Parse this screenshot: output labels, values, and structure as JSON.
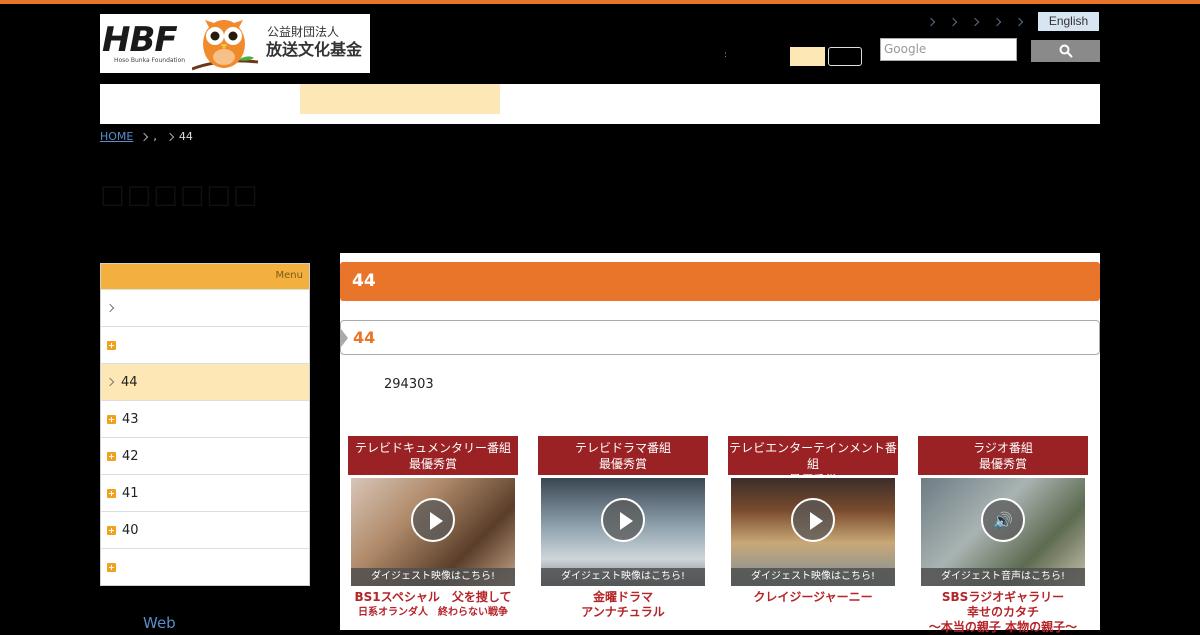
{
  "logo": {
    "mark": "HBF",
    "tagline": "Hoso Bunka Foundation",
    "org_line1": "公益財団法人",
    "org_line2": "放送文化基金"
  },
  "header": {
    "english_label": "English",
    "colon": ":",
    "search_placeholder": "Google"
  },
  "breadcrumb": {
    "home": "HOME",
    "middle": ",",
    "current": "44"
  },
  "page_title": "□□□□□□",
  "sidebar": {
    "menu_label": "Menu",
    "items": [
      {
        "label": "",
        "icon": "chevron-right-icon"
      },
      {
        "label": "",
        "icon": "plus-icon"
      },
      {
        "label": "44",
        "icon": "chevron-right-icon"
      },
      {
        "label": "43",
        "icon": "plus-icon"
      },
      {
        "label": "42",
        "icon": "plus-icon"
      },
      {
        "label": "41",
        "icon": "plus-icon"
      },
      {
        "label": "40",
        "icon": "plus-icon"
      },
      {
        "label": "",
        "icon": "plus-icon"
      }
    ]
  },
  "web_link": "Web",
  "main": {
    "title": "44",
    "subtitle": "44",
    "count": "294303"
  },
  "cards": [
    {
      "head1": "テレビドキュメンタリー番組",
      "head2": "最優秀賞",
      "strip": "ダイジェスト映像はこちら!",
      "title1": "BS1スペシャル　父を捜して",
      "title2": "日系オランダ人　終わらない戦争",
      "media": "play-icon"
    },
    {
      "head1": "テレビドラマ番組",
      "head2": "最優秀賞",
      "strip": "ダイジェスト映像はこちら!",
      "title1": "金曜ドラマ",
      "title2": "アンナチュラル",
      "media": "play-icon"
    },
    {
      "head1": "テレビエンターテインメント番組",
      "head2": "最優秀賞",
      "strip": "ダイジェスト映像はこちら!",
      "title1": "",
      "title2": "クレイジージャーニー",
      "media": "play-icon"
    },
    {
      "head1": "ラジオ番組",
      "head2": "最優秀賞",
      "strip": "ダイジェスト音声はこちら!",
      "title1": "SBSラジオギャラリー",
      "title2": "幸せのカタチ",
      "title3": "～本当の親子 本物の親子～",
      "media": "speaker-icon"
    }
  ],
  "colors": {
    "accent_orange": "#e8752a",
    "award_red": "#9b2224",
    "highlight": "#fde7b4",
    "menu_header": "#f4b03e"
  }
}
